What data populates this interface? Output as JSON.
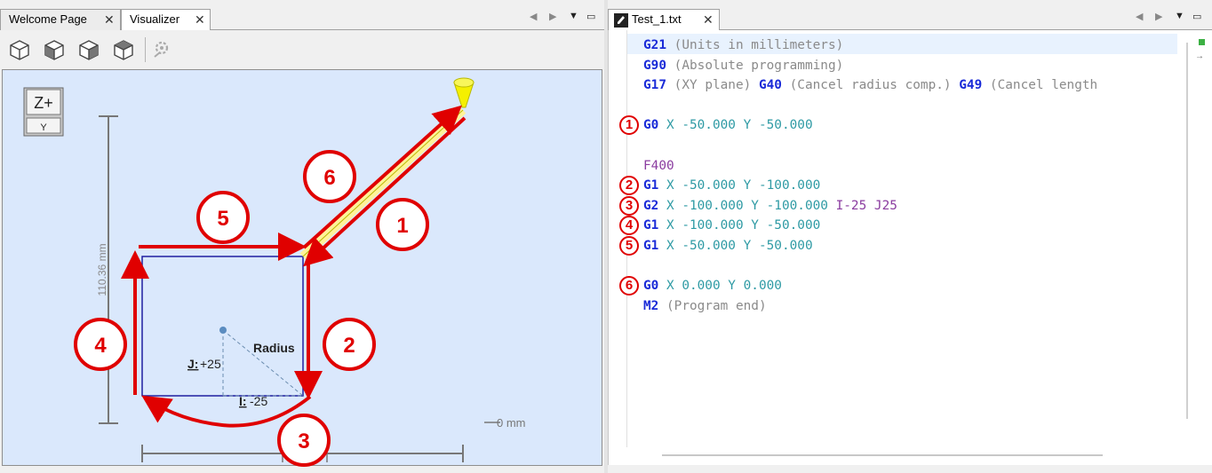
{
  "left_pane": {
    "tabs": [
      {
        "label": "Welcome Page",
        "close": "✕",
        "active": false
      },
      {
        "label": "Visualizer",
        "close": "✕",
        "active": true
      }
    ],
    "toolbar": {
      "buttons": [
        "iso-view-icon",
        "front-view-icon",
        "side-view-icon",
        "top-view-icon",
        "settings-icon"
      ]
    },
    "visualizer": {
      "view_cube": {
        "top_label": "Z+",
        "bottom_label": "Y"
      },
      "dimension_vertical": "110.36 mm",
      "scale_label": "0 mm",
      "annotations": {
        "radius": "Radius",
        "j_prefix": "J:",
        "j_value": "+25",
        "i_prefix": "I:",
        "i_value": "-25"
      },
      "step_badges": [
        "1",
        "2",
        "3",
        "4",
        "5",
        "6"
      ]
    }
  },
  "right_pane": {
    "tab": {
      "label": "Test_1.txt",
      "close": "✕",
      "active": true
    },
    "lines": [
      {
        "badge": "",
        "parts": [
          {
            "t": "G21",
            "c": "cmd"
          },
          {
            "t": " (Units in millimeters)",
            "c": "cmt"
          }
        ]
      },
      {
        "badge": "",
        "parts": [
          {
            "t": "G90",
            "c": "cmd"
          },
          {
            "t": " (Absolute programming)",
            "c": "cmt"
          }
        ]
      },
      {
        "badge": "",
        "parts": [
          {
            "t": "G17",
            "c": "cmd"
          },
          {
            "t": " (XY plane) ",
            "c": "cmt"
          },
          {
            "t": "G40",
            "c": "cmd"
          },
          {
            "t": " (Cancel radius comp.) ",
            "c": "cmt"
          },
          {
            "t": "G49",
            "c": "cmd"
          },
          {
            "t": " (Cancel length",
            "c": "cmt"
          }
        ]
      },
      {
        "badge": "",
        "parts": []
      },
      {
        "badge": "1",
        "parts": [
          {
            "t": "G0",
            "c": "cmd"
          },
          {
            "t": " X -50.000 Y -50.000",
            "c": "coord"
          }
        ]
      },
      {
        "badge": "",
        "parts": []
      },
      {
        "badge": "",
        "parts": [
          {
            "t": "F400",
            "c": "feed"
          }
        ]
      },
      {
        "badge": "2",
        "parts": [
          {
            "t": "G1",
            "c": "cmd"
          },
          {
            "t": " X -50.000 Y -100.000",
            "c": "coord"
          }
        ]
      },
      {
        "badge": "3",
        "parts": [
          {
            "t": "G2",
            "c": "cmd"
          },
          {
            "t": " X -100.000 Y -100.000 ",
            "c": "coord"
          },
          {
            "t": "I-25 J25",
            "c": "feed"
          }
        ]
      },
      {
        "badge": "4",
        "parts": [
          {
            "t": "G1",
            "c": "cmd"
          },
          {
            "t": " X -100.000 Y -50.000",
            "c": "coord"
          }
        ]
      },
      {
        "badge": "5",
        "parts": [
          {
            "t": "G1",
            "c": "cmd"
          },
          {
            "t": " X -50.000 Y -50.000",
            "c": "coord"
          }
        ]
      },
      {
        "badge": "",
        "parts": []
      },
      {
        "badge": "6",
        "parts": [
          {
            "t": "G0",
            "c": "cmd"
          },
          {
            "t": " X 0.000 Y 0.000",
            "c": "coord"
          }
        ]
      },
      {
        "badge": "",
        "parts": [
          {
            "t": "M2",
            "c": "cmd"
          },
          {
            "t": " (Program end)",
            "c": "cmt"
          }
        ]
      }
    ]
  },
  "colors": {
    "canvas_bg": "#dae8fc",
    "toolpath": "#1f1fa0",
    "arrow": "#e00000",
    "tool": "#f0f000",
    "command": "#1a2bd8",
    "comment": "#8a8a8a",
    "coordinate": "#2e9aa4",
    "feed": "#8b3da0"
  }
}
